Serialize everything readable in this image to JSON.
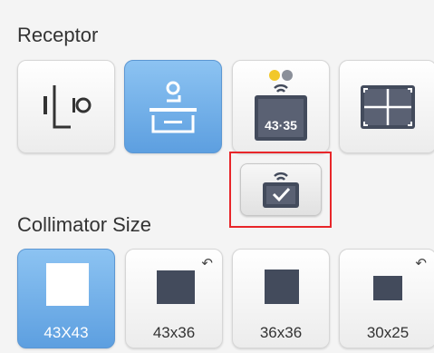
{
  "receptor": {
    "title": "Receptor",
    "buttons": [
      {
        "name": "wall-stand",
        "icon": "wall-stand-icon",
        "active": false
      },
      {
        "name": "table",
        "icon": "table-receptor-icon",
        "active": true
      },
      {
        "name": "wireless-detector",
        "icon": "wireless-detector-icon",
        "label": "43·35",
        "active": false
      },
      {
        "name": "full-detector",
        "icon": "detector-grid-icon",
        "active": false
      }
    ],
    "confirm_detector": {
      "icon": "detector-check-icon"
    }
  },
  "collimator": {
    "title": "Collimator Size",
    "sizes": [
      {
        "label": "43X43",
        "active": true,
        "rotate": false
      },
      {
        "label": "43x36",
        "active": false,
        "rotate": true
      },
      {
        "label": "36x36",
        "active": false,
        "rotate": false
      },
      {
        "label": "30x25",
        "active": false,
        "rotate": true
      }
    ],
    "rotate_symbol": "↶"
  },
  "colors": {
    "accent": "#6aa9e6",
    "highlight": "#e8262a",
    "icon_dark": "#434b5c"
  }
}
